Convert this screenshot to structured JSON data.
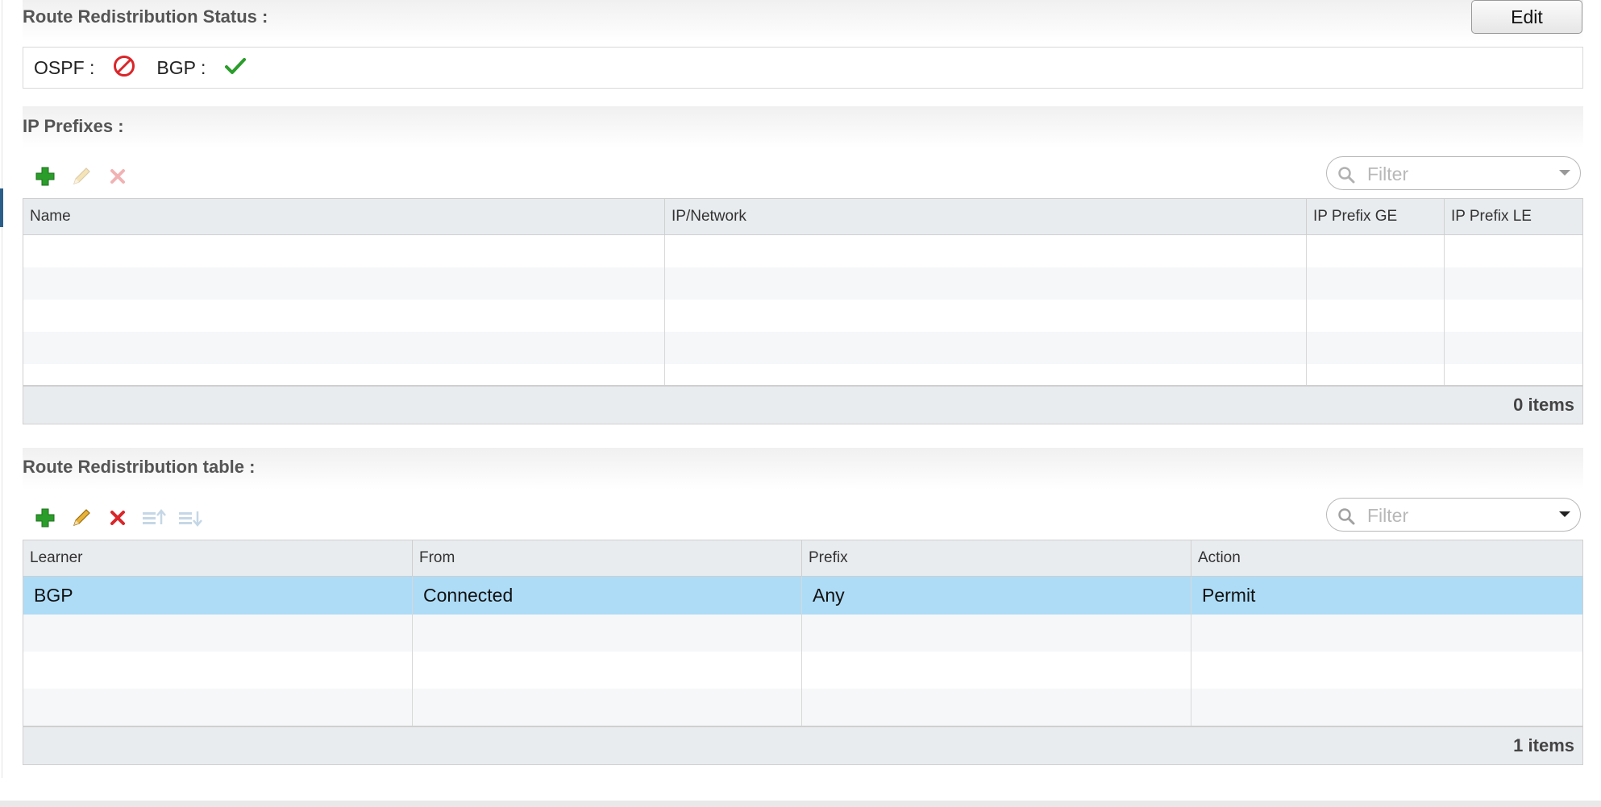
{
  "route_status": {
    "title": "Route Redistribution Status :",
    "edit_label": "Edit",
    "ospf_label": "OSPF :",
    "ospf_state_icon": "disabled-icon",
    "bgp_label": "BGP :",
    "bgp_state_icon": "check-icon"
  },
  "ip_prefixes": {
    "title": "IP Prefixes :",
    "filter_placeholder": "Filter",
    "columns": [
      "Name",
      "IP/Network",
      "IP Prefix GE",
      "IP Prefix LE"
    ],
    "rows": [],
    "footer": "0 items"
  },
  "redistribution_table": {
    "title": "Route Redistribution table :",
    "filter_placeholder": "Filter",
    "columns": [
      "Learner",
      "From",
      "Prefix",
      "Action"
    ],
    "rows": [
      [
        "BGP",
        "Connected",
        "Any",
        "Permit"
      ]
    ],
    "footer": "1 items"
  },
  "colors": {
    "selected_row": "#aedcf7",
    "header_bg": "#e9ecef",
    "add_green": "#2a9d2a",
    "delete_red": "#d9262a",
    "ok_green": "#2a9d2a"
  }
}
